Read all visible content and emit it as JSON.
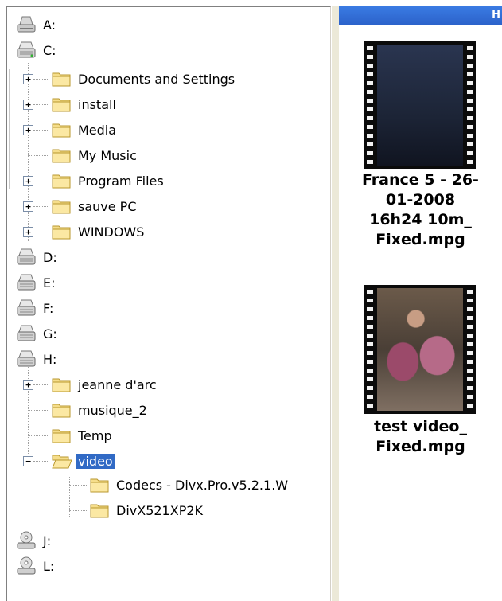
{
  "tree": {
    "items": [
      {
        "label": "A:",
        "kind": "floppy"
      },
      {
        "label": "C:",
        "kind": "drive"
      },
      {
        "label": "Documents and Settings",
        "kind": "folder",
        "expander": "+"
      },
      {
        "label": "install",
        "kind": "folder",
        "expander": "+"
      },
      {
        "label": "Media",
        "kind": "folder",
        "expander": "+"
      },
      {
        "label": "My Music",
        "kind": "folder"
      },
      {
        "label": "Program Files",
        "kind": "folder",
        "expander": "+"
      },
      {
        "label": "sauve PC",
        "kind": "folder",
        "expander": "+"
      },
      {
        "label": "WINDOWS",
        "kind": "folder",
        "expander": "+"
      },
      {
        "label": "D:",
        "kind": "drive"
      },
      {
        "label": "E:",
        "kind": "drive"
      },
      {
        "label": "F:",
        "kind": "drive"
      },
      {
        "label": "G:",
        "kind": "drive"
      },
      {
        "label": "H:",
        "kind": "drive"
      },
      {
        "label": "jeanne d'arc",
        "kind": "folder",
        "expander": "+"
      },
      {
        "label": "musique_2",
        "kind": "folder"
      },
      {
        "label": "Temp",
        "kind": "folder"
      },
      {
        "label": "video",
        "kind": "folder-open",
        "expander": "−",
        "selected": true
      },
      {
        "label": "Codecs - Divx.Pro.v5.2.1.W",
        "kind": "folder"
      },
      {
        "label": "DivX521XP2K",
        "kind": "folder"
      },
      {
        "label": "J:",
        "kind": "cdrom"
      },
      {
        "label": "L:",
        "kind": "cdrom"
      }
    ]
  },
  "files_pane": {
    "header_text": "H",
    "files": [
      {
        "name_line1": "France 5 - 26-",
        "name_line2": "01-2008",
        "name_line3": "16h24 10m_",
        "name_line4": "Fixed.mpg"
      },
      {
        "name_line1": "test video_",
        "name_line2": "Fixed.mpg"
      }
    ]
  },
  "colors": {
    "selection": "#316ac5",
    "header_bar": "#2b61c9",
    "folder": "#f5dd8a",
    "film": "#0b0b0b"
  }
}
